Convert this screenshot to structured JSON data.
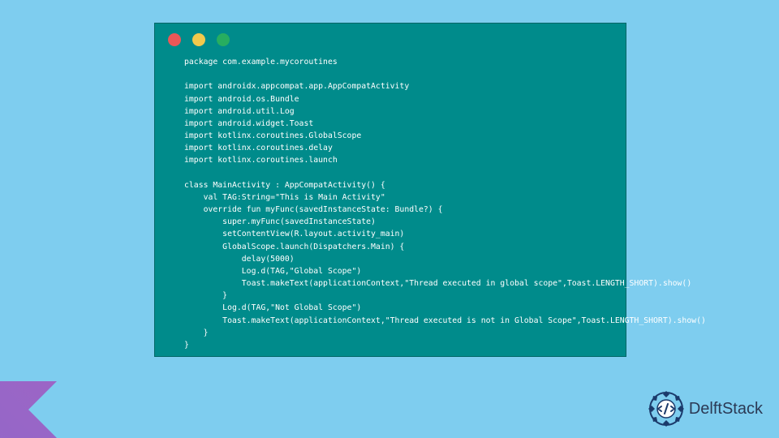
{
  "code": {
    "lines": [
      "package com.example.mycoroutines",
      "",
      "import androidx.appcompat.app.AppCompatActivity",
      "import android.os.Bundle",
      "import android.util.Log",
      "import android.widget.Toast",
      "import kotlinx.coroutines.GlobalScope",
      "import kotlinx.coroutines.delay",
      "import kotlinx.coroutines.launch",
      "",
      "class MainActivity : AppCompatActivity() {",
      "    val TAG:String=\"This is Main Activity\"",
      "    override fun myFunc(savedInstanceState: Bundle?) {",
      "        super.myFunc(savedInstanceState)",
      "        setContentView(R.layout.activity_main)",
      "        GlobalScope.launch(Dispatchers.Main) {",
      "            delay(5000)",
      "            Log.d(TAG,\"Global Scope\")",
      "            Toast.makeText(applicationContext,\"Thread executed in global scope\",Toast.LENGTH_SHORT).show()",
      "        }",
      "        Log.d(TAG,\"Not Global Scope\")",
      "        Toast.makeText(applicationContext,\"Thread executed is not in Global Scope\",Toast.LENGTH_SHORT).show()",
      "    }",
      "}"
    ]
  },
  "brand": {
    "name": "DelftStack"
  },
  "colors": {
    "page_bg": "#7ecdef",
    "window_bg": "#008b8b",
    "code_fg": "#ffffff",
    "red": "#eb5757",
    "yellow": "#f2c94c",
    "green": "#27ae60",
    "delft_blue": "#1b3a6b",
    "kotlin_orange": "#f88909",
    "kotlin_purple": "#7f52ff"
  }
}
